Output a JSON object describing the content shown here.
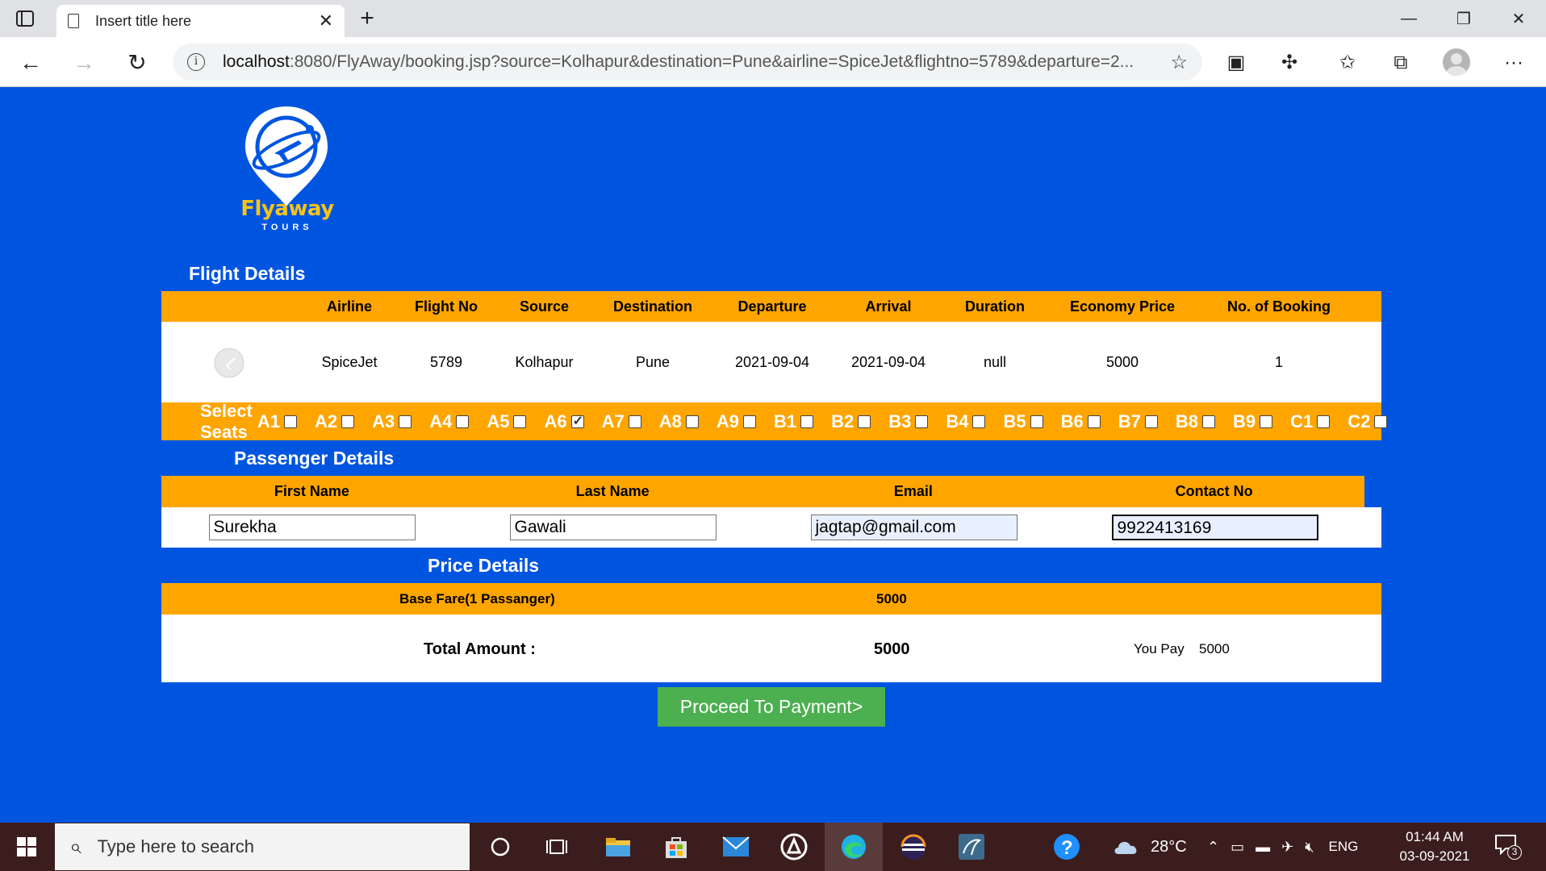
{
  "browser": {
    "tab_title": "Insert title here",
    "url_host": "localhost",
    "url_rest": ":8080/FlyAway/booking.jsp?source=Kolhapur&destination=Pune&airline=SpiceJet&flightno=5789&departure=2..."
  },
  "brand": {
    "name": "Flyaway",
    "tagline": "TOURS"
  },
  "flight_details": {
    "heading": "Flight Details",
    "columns": [
      "Airline",
      "Flight No",
      "Source",
      "Destination",
      "Departure",
      "Arrival",
      "Duration",
      "Economy Price",
      "No. of Booking"
    ],
    "row": [
      "SpiceJet",
      "5789",
      "Kolhapur",
      "Pune",
      "2021-09-04",
      "2021-09-04",
      "null",
      "5000",
      "1"
    ]
  },
  "seats": {
    "label": "Select Seats",
    "items": [
      {
        "id": "A1",
        "checked": false
      },
      {
        "id": "A2",
        "checked": false
      },
      {
        "id": "A3",
        "checked": false
      },
      {
        "id": "A4",
        "checked": false
      },
      {
        "id": "A5",
        "checked": false
      },
      {
        "id": "A6",
        "checked": true
      },
      {
        "id": "A7",
        "checked": false
      },
      {
        "id": "A8",
        "checked": false
      },
      {
        "id": "A9",
        "checked": false
      },
      {
        "id": "B1",
        "checked": false
      },
      {
        "id": "B2",
        "checked": false
      },
      {
        "id": "B3",
        "checked": false
      },
      {
        "id": "B4",
        "checked": false
      },
      {
        "id": "B5",
        "checked": false
      },
      {
        "id": "B6",
        "checked": false
      },
      {
        "id": "B7",
        "checked": false
      },
      {
        "id": "B8",
        "checked": false
      },
      {
        "id": "B9",
        "checked": false
      },
      {
        "id": "C1",
        "checked": false
      },
      {
        "id": "C2",
        "checked": false
      }
    ]
  },
  "passenger": {
    "heading": "Passenger Details",
    "columns": [
      "First Name",
      "Last Name",
      "Email",
      "Contact No"
    ],
    "values": [
      "Surekha",
      "Gawali",
      "jagtap@gmail.com",
      "9922413169"
    ]
  },
  "price": {
    "heading": "Price Details",
    "base_fare_label": "Base Fare(1 Passanger)",
    "base_fare_value": "5000",
    "total_label": "Total Amount :",
    "total_value": "5000",
    "you_pay_label": "You Pay",
    "you_pay_value": "5000"
  },
  "actions": {
    "proceed_label": "Proceed To Payment>"
  },
  "taskbar": {
    "search_placeholder": "Type here to search",
    "weather": "28°C",
    "language": "ENG",
    "time": "01:44 AM",
    "date": "03-09-2021",
    "notification_count": "3"
  },
  "colors": {
    "page_bg": "#0055e0",
    "table_header": "#ffa500",
    "pay_button": "#4caf50",
    "logo_text": "#f5c31b"
  }
}
